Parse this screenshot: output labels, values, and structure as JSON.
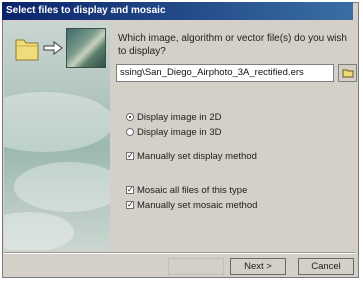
{
  "window": {
    "title": "Select files to display and mosaic"
  },
  "prompt": "Which image, algorithm or vector file(s) do you wish to display?",
  "path_value": "ssing\\San_Diego_Airphoto_3A_rectified.ers",
  "display_options": [
    {
      "label": "Display image in 2D",
      "checked": true
    },
    {
      "label": "Display image in 3D",
      "checked": false
    }
  ],
  "checkboxes": [
    {
      "label": "Manually set display method",
      "checked": true
    },
    {
      "label": "Mosaic all files of this type",
      "checked": true
    },
    {
      "label": "Manually set mosaic method",
      "checked": true
    }
  ],
  "buttons": {
    "next": "Next >",
    "cancel": "Cancel"
  },
  "icons": {
    "folder": "folder-icon",
    "arrow": "arrow-right-icon",
    "mosaic": "mosaic-image-icon",
    "browse": "browse-icon"
  }
}
